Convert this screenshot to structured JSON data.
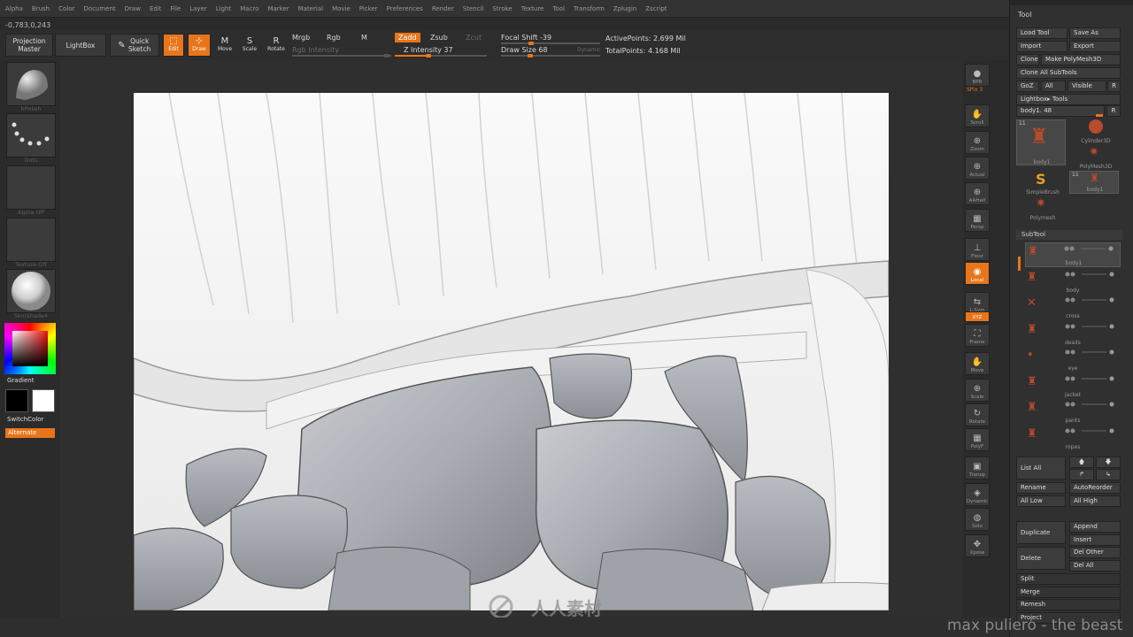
{
  "menu": {
    "items": [
      "Alpha",
      "Brush",
      "Color",
      "Document",
      "Draw",
      "Edit",
      "File",
      "Layer",
      "Light",
      "Macro",
      "Marker",
      "Material",
      "Movie",
      "Picker",
      "Preferences",
      "Render",
      "Stencil",
      "Stroke",
      "Texture",
      "Tool",
      "Transform",
      "Zplugin",
      "Zscript"
    ]
  },
  "coords": "-0,783,0,243",
  "toolbar": {
    "projection_master": "Projection Master",
    "lightbox": "LightBox",
    "quick_sketch": "Quick Sketch",
    "edit": "Edit",
    "draw": "Draw",
    "move": "Move",
    "scale": "Scale",
    "rotate": "Rotate",
    "mrgb": "Mrgb",
    "rgb": "Rgb",
    "m": "M",
    "zadd": "Zadd",
    "zsub": "Zsub",
    "zcut": "Zcut",
    "rgb_intensity": "Rgb Intensity",
    "z_intensity": "Z Intensity 37",
    "focal_shift": "Focal Shift -39",
    "draw_size": "Draw Size 68",
    "dynamic": "Dynamic",
    "active_points": "ActivePoints: 2.699 Mil",
    "total_points": "TotalPoints: 4.168 Mil",
    "z_intensity_value": 37,
    "focal_shift_value": -39,
    "draw_size_value": 68
  },
  "left_shelf": {
    "brush_label": "hPolish",
    "stroke_label": "Dots",
    "alpha_label": "Alpha Off",
    "texture_label": "Texture Off",
    "material_label": "SkinShade4",
    "gradient": "Gradient",
    "switch_color": "SwitchColor",
    "alternate": "Alternate"
  },
  "right_shelf": {
    "items": [
      {
        "label": "BPR",
        "icon": "sphere-icon"
      },
      {
        "label": "SPix 3",
        "icon": "slider-icon"
      },
      {
        "label": "Scroll",
        "icon": "hand-icon"
      },
      {
        "label": "Zoom",
        "icon": "zoom-icon"
      },
      {
        "label": "Actual",
        "icon": "zoom-icon"
      },
      {
        "label": "AAHalf",
        "icon": "zoom-icon"
      },
      {
        "label": "Persp",
        "icon": "grid-icon"
      },
      {
        "label": "Floor",
        "icon": "floor-icon"
      },
      {
        "label": "Local",
        "icon": "local-icon"
      },
      {
        "label": "L.Sym",
        "icon": "sym-icon"
      },
      {
        "label": "XYZ",
        "icon": "xyz-icon"
      },
      {
        "label": "Frame",
        "icon": "frame-icon"
      },
      {
        "label": "Move",
        "icon": "hand-icon"
      },
      {
        "label": "Scale",
        "icon": "zoom-icon"
      },
      {
        "label": "Rotate",
        "icon": "rotate-icon"
      },
      {
        "label": "PolyF",
        "icon": "grid-icon"
      },
      {
        "label": "Transp",
        "icon": "transp-icon"
      },
      {
        "label": "Dynamic",
        "icon": "dynamic-icon"
      },
      {
        "label": "Solo",
        "icon": "solo-icon"
      },
      {
        "label": "Xpose",
        "icon": "xpose-icon"
      }
    ]
  },
  "tool_palette": {
    "title": "Tool",
    "load_tool": "Load Tool",
    "save_as": "Save As",
    "import": "Import",
    "export": "Export",
    "clone": "Clone",
    "make_polymesh": "Make PolyMesh3D",
    "clone_all": "Clone All SubTools",
    "goz": "GoZ",
    "all": "All",
    "visible": "Visible",
    "r": "R",
    "lightbox_tools": "Lightbox▸ Tools",
    "current_tool": "body1. 48",
    "tools": [
      {
        "name": "body1",
        "count": "11"
      },
      {
        "name": "Cylinder3D"
      },
      {
        "name": "PolyMesh3D"
      },
      {
        "name": "SimpleBrush"
      },
      {
        "name": "body1",
        "count": "11"
      },
      {
        "name": "Polymesh"
      }
    ],
    "subtool_header": "SubTool",
    "subtools": [
      "body1",
      "body",
      "cross",
      "deails",
      "eye",
      "jacket",
      "pants",
      "ropes"
    ],
    "list_all": "List All",
    "rename": "Rename",
    "auto_reorder": "AutoReorder",
    "all_low": "All Low",
    "all_high": "All High",
    "duplicate": "Duplicate",
    "append": "Append",
    "insert": "Insert",
    "delete": "Delete",
    "del_other": "Del Other",
    "del_all": "Del All",
    "split": "Split",
    "merge": "Merge",
    "remesh": "Remesh",
    "project": "Project"
  },
  "watermark": "max puliero - the beast",
  "site_mark": "人人素材",
  "colors": {
    "accent": "#e8751a",
    "bg": "#2a2a2a",
    "canvas": "#fdfdfd"
  }
}
